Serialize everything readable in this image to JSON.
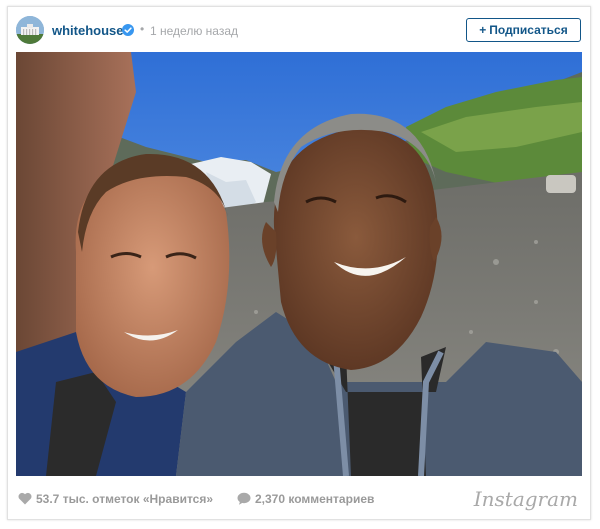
{
  "header": {
    "username": "whitehouse",
    "separator": "•",
    "time_ago": "1 неделю назад",
    "follow_label": "Подписаться",
    "follow_plus": "+"
  },
  "footer": {
    "likes": "53.7 тыс. отметок «Нравится»",
    "comments": "2,370 комментариев",
    "brand": "Instagram"
  },
  "colors": {
    "link": "#125688",
    "verified": "#3897f0",
    "muted": "#9a9a9a"
  },
  "icons": {
    "verified": "verified-badge-icon",
    "heart": "heart-icon",
    "comment": "comment-icon"
  }
}
